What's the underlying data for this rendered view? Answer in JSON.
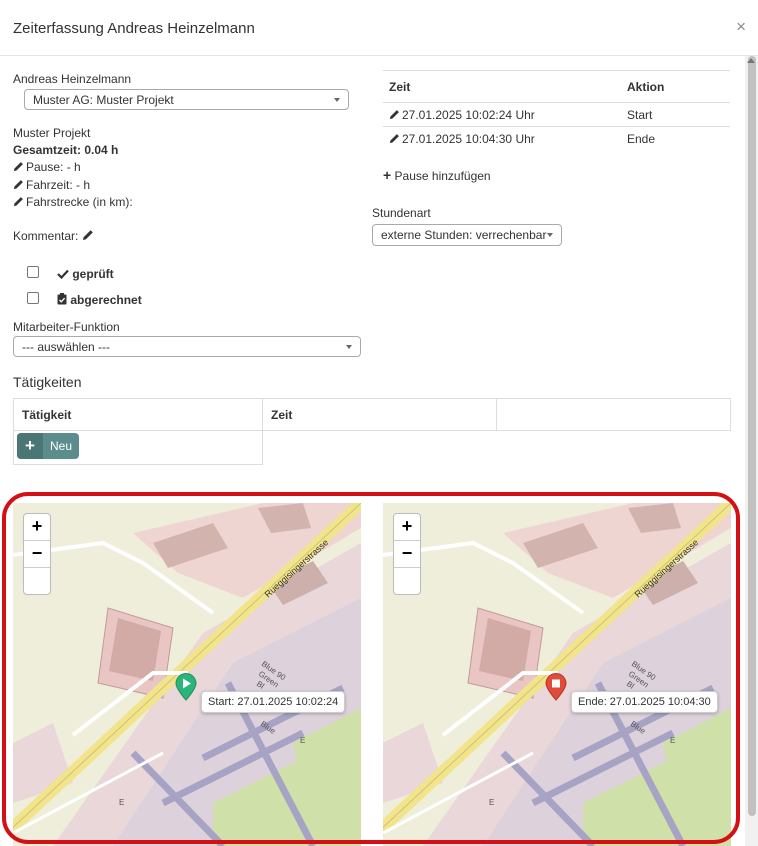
{
  "dialog": {
    "title": "Zeiterfassung Andreas Heinzelmann",
    "close_symbol": "×"
  },
  "left": {
    "employee_name": "Andreas Heinzelmann",
    "project_select": "Muster AG: Muster Projekt",
    "project_name": "Muster Projekt",
    "total_time": "Gesamtzeit: 0.04 h",
    "pause": "Pause: - h",
    "fahrzeit": "Fahrzeit: - h",
    "fahrstrecke": "Fahrstrecke (in km):",
    "kommentar": "Kommentar:",
    "checked_label": "geprüft",
    "billed_label": "abgerechnet",
    "funktion_label": "Mitarbeiter-Funktion",
    "funktion_select": "--- auswählen ---",
    "activities_heading": "Tätigkeiten",
    "activities_table": {
      "col1": "Tätigkeit",
      "col2": "Zeit"
    },
    "new_button": "Neu"
  },
  "right": {
    "table_headers": {
      "time": "Zeit",
      "action": "Aktion"
    },
    "rows": [
      {
        "time": "27.01.2025 10:02:24 Uhr",
        "action": "Start"
      },
      {
        "time": "27.01.2025 10:04:30 Uhr",
        "action": "Ende"
      }
    ],
    "add_pause": "Pause hinzufügen",
    "stundenart_label": "Stundenart",
    "stundenart_select": "externe Stunden: verrechenbar"
  },
  "maps": [
    {
      "popup": "Start: 27.01.2025 10:02:24",
      "marker": "play-icon",
      "marker_color": "#2bb57a",
      "street": "Rueggisingerstrasse"
    },
    {
      "popup": "Ende: 27.01.2025 10:04:30",
      "marker": "stop-icon",
      "marker_color": "#e04b3a",
      "street": "Rueggisingerstrasse"
    }
  ],
  "map_labels": {
    "zoom_in": "+",
    "zoom_out": "−",
    "poi1": "Blue 90",
    "poi2": "Green",
    "poi3": "Bl",
    "poi4": "Blue",
    "poi5": "E"
  },
  "colors": {
    "highlight": "#d51014",
    "button": "#5a8d8c"
  }
}
